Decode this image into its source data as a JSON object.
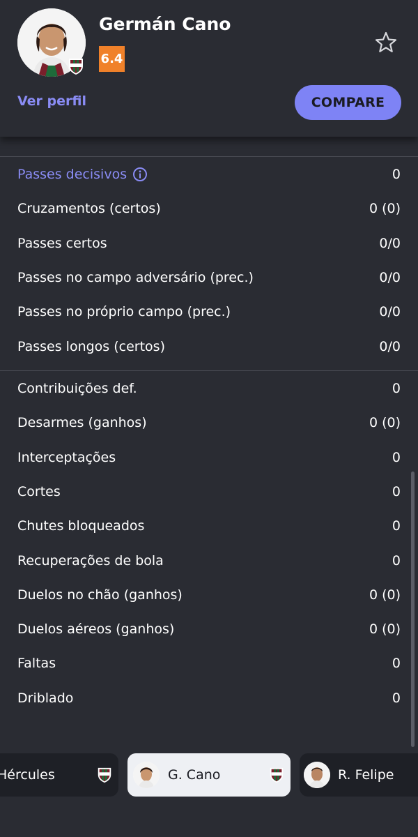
{
  "player": {
    "name": "Germán Cano",
    "rating": "6.4",
    "view_profile": "Ver perfil",
    "compare": "COMPARE"
  },
  "colors": {
    "background": "#2a2c33",
    "accent": "#8a8cf5",
    "rating": "#f0812a",
    "compare_button": "#7e83f5"
  },
  "sections": [
    {
      "rows": [
        {
          "label": "Passes decisivos",
          "value": "0",
          "highlight": true,
          "icon": "info-icon"
        },
        {
          "label": "Cruzamentos (certos)",
          "value": "0 (0)"
        },
        {
          "label": "Passes certos",
          "value": "0/0"
        },
        {
          "label": "Passes no campo adversário (prec.)",
          "value": "0/0"
        },
        {
          "label": "Passes no próprio campo (prec.)",
          "value": "0/0"
        },
        {
          "label": "Passes longos (certos)",
          "value": "0/0"
        }
      ]
    },
    {
      "rows": [
        {
          "label": "Contribuições def.",
          "value": "0"
        },
        {
          "label": "Desarmes (ganhos)",
          "value": "0 (0)"
        },
        {
          "label": "Interceptações",
          "value": "0"
        },
        {
          "label": "Cortes",
          "value": "0"
        },
        {
          "label": "Chutes bloqueados",
          "value": "0"
        },
        {
          "label": "Recuperações de bola",
          "value": "0"
        },
        {
          "label": "Duelos no chão (ganhos)",
          "value": "0 (0)"
        },
        {
          "label": "Duelos aéreos (ganhos)",
          "value": "0 (0)"
        },
        {
          "label": "Faltas",
          "value": "0"
        },
        {
          "label": "Driblado",
          "value": "0"
        }
      ]
    }
  ],
  "bottom_players": [
    {
      "name": "Hércules"
    },
    {
      "name": "G. Cano"
    },
    {
      "name": "R. Felipe"
    }
  ]
}
